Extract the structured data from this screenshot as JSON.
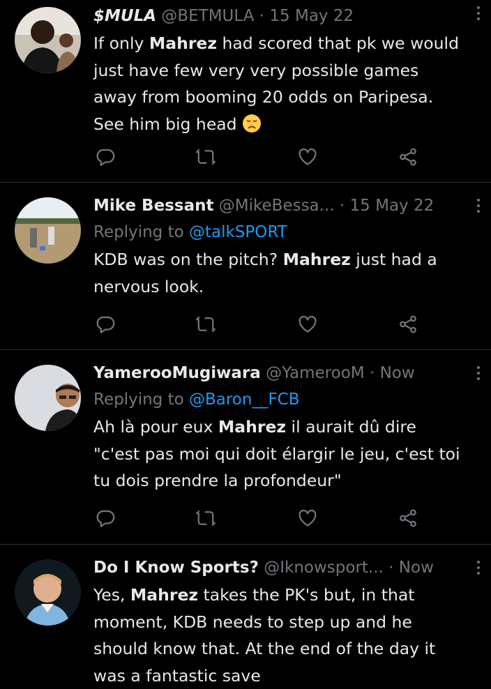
{
  "tweets": [
    {
      "name": "$MULA",
      "handle": "@BETMULA",
      "sep": "·",
      "time": "15 May 22",
      "text_parts": [
        "If only ",
        "Mahrez",
        " had scored that pk we would just have few very very possible games away from booming 20 odds on Paripesa. See him big head "
      ],
      "emoji": "disappointed-face-emoji"
    },
    {
      "name": "Mike Bessant",
      "handle": "@MikeBessa...",
      "sep": "·",
      "time": "15 May 22",
      "replying_prefix": "Replying to ",
      "replying_to": "@talkSPORT",
      "text_parts": [
        "KDB was on the pitch? ",
        "Mahrez",
        " just had a nervous look."
      ]
    },
    {
      "name": "YamerooMugiwara",
      "handle": "@YamerooM",
      "sep": "·",
      "time": "Now",
      "replying_prefix": "Replying to ",
      "replying_to": "@Baron__FCB",
      "text_parts": [
        "Ah là pour eux ",
        "Mahrez",
        " il aurait dû dire \"c'est pas moi qui doit élargir le jeu, c'est toi tu dois prendre la profondeur\""
      ]
    },
    {
      "name": "Do I Know Sports?",
      "handle": "@Iknowsport...",
      "sep": "·",
      "time": "Now",
      "text_parts": [
        "Yes, ",
        "Mahrez",
        " takes the PK's but, in that moment, KDB needs to step up and he should know that. At the end of the day it was a fantastic save"
      ]
    }
  ],
  "colors": {
    "background": "#000000",
    "text": "#e7e9ea",
    "muted": "#71767b",
    "link": "#1d9bf0",
    "divider": "#2f3336"
  },
  "icons": [
    "reply-icon",
    "retweet-icon",
    "like-icon",
    "share-icon",
    "more-icon"
  ]
}
